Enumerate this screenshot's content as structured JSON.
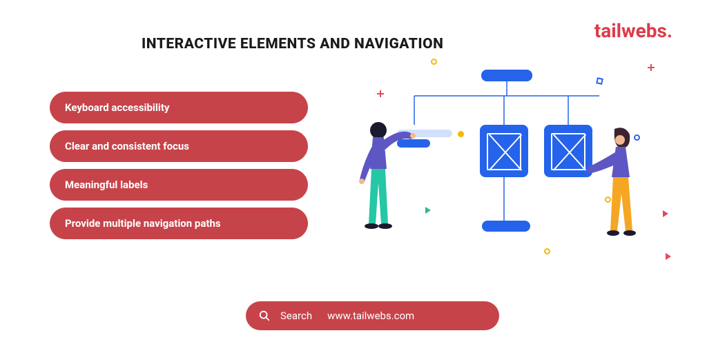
{
  "brand": {
    "name": "tailwebs."
  },
  "title": "INTERACTIVE ELEMENTS AND NAVIGATION",
  "pills": [
    "Keyboard accessibility",
    "Clear and consistent focus",
    "Meaningful labels",
    "Provide multiple navigation paths"
  ],
  "search": {
    "label": "Search",
    "value": "www.tailwebs.com"
  },
  "colors": {
    "accent": "#c7434a",
    "brand": "#de3a4a",
    "node": "#2563eb"
  }
}
